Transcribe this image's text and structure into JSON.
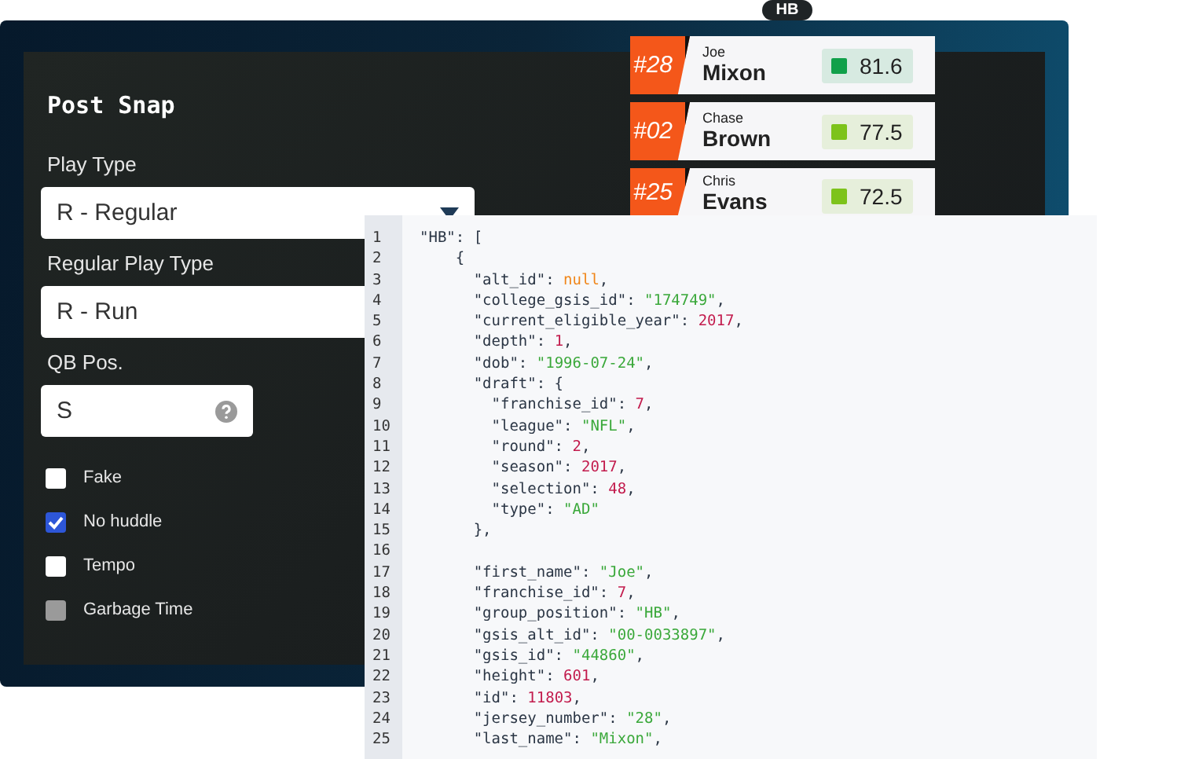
{
  "badge": "HB",
  "form": {
    "title": "Post Snap",
    "fields": [
      {
        "kind": "select",
        "label": "Play Type",
        "value": "R - Regular"
      },
      {
        "kind": "covered",
        "label": "Regular Play Type",
        "value": "R - Run"
      },
      {
        "kind": "input",
        "label": "QB Pos.",
        "value": "S"
      }
    ],
    "checkboxes": [
      {
        "label": "Fake",
        "checked": false,
        "disabled": false
      },
      {
        "label": "No huddle",
        "checked": true,
        "disabled": false
      },
      {
        "label": "Tempo",
        "checked": false,
        "disabled": false
      },
      {
        "label": "Garbage Time",
        "checked": false,
        "disabled": true
      }
    ]
  },
  "players": [
    {
      "number": "#28",
      "first_name": "Joe",
      "last_name": "Mixon",
      "rating": "81.6",
      "color": "#11a04a"
    },
    {
      "number": "#02",
      "first_name": "Chase",
      "last_name": "Brown",
      "rating": "77.5",
      "color": "#7dc31b"
    },
    {
      "number": "#25",
      "first_name": "Chris",
      "last_name": "Evans",
      "rating": "72.5",
      "color": "#7dc31b"
    }
  ],
  "code": [
    {
      "line": "1",
      "tokens": [
        {
          "kind": "key",
          "text": "\"HB\""
        },
        {
          "kind": "punct",
          "text": ": ["
        }
      ]
    },
    {
      "line": "2",
      "tokens": [
        {
          "kind": "punct",
          "text": "    {"
        }
      ]
    },
    {
      "line": "3",
      "tokens": [
        {
          "kind": "key",
          "text": "      \"alt_id\""
        },
        {
          "kind": "punct",
          "text": ": "
        },
        {
          "kind": "null",
          "text": "null"
        },
        {
          "kind": "punct",
          "text": ","
        }
      ]
    },
    {
      "line": "4",
      "tokens": [
        {
          "kind": "key",
          "text": "      \"college_gsis_id\""
        },
        {
          "kind": "punct",
          "text": ": "
        },
        {
          "kind": "string",
          "text": "\"174749\""
        },
        {
          "kind": "punct",
          "text": ","
        }
      ]
    },
    {
      "line": "5",
      "tokens": [
        {
          "kind": "key",
          "text": "      \"current_eligible_year\""
        },
        {
          "kind": "punct",
          "text": ": "
        },
        {
          "kind": "number",
          "text": "2017"
        },
        {
          "kind": "punct",
          "text": ","
        }
      ]
    },
    {
      "line": "6",
      "tokens": [
        {
          "kind": "key",
          "text": "      \"depth\""
        },
        {
          "kind": "punct",
          "text": ": "
        },
        {
          "kind": "number",
          "text": "1"
        },
        {
          "kind": "punct",
          "text": ","
        }
      ]
    },
    {
      "line": "7",
      "tokens": [
        {
          "kind": "key",
          "text": "      \"dob\""
        },
        {
          "kind": "punct",
          "text": ": "
        },
        {
          "kind": "string",
          "text": "\"1996-07-24\""
        },
        {
          "kind": "punct",
          "text": ","
        }
      ]
    },
    {
      "line": "8",
      "tokens": [
        {
          "kind": "key",
          "text": "      \"draft\""
        },
        {
          "kind": "punct",
          "text": ": {"
        }
      ]
    },
    {
      "line": "9",
      "tokens": [
        {
          "kind": "key",
          "text": "        \"franchise_id\""
        },
        {
          "kind": "punct",
          "text": ": "
        },
        {
          "kind": "number",
          "text": "7"
        },
        {
          "kind": "punct",
          "text": ","
        }
      ]
    },
    {
      "line": "10",
      "tokens": [
        {
          "kind": "key",
          "text": "        \"league\""
        },
        {
          "kind": "punct",
          "text": ": "
        },
        {
          "kind": "string",
          "text": "\"NFL\""
        },
        {
          "kind": "punct",
          "text": ","
        }
      ]
    },
    {
      "line": "11",
      "tokens": [
        {
          "kind": "key",
          "text": "        \"round\""
        },
        {
          "kind": "punct",
          "text": ": "
        },
        {
          "kind": "number",
          "text": "2"
        },
        {
          "kind": "punct",
          "text": ","
        }
      ]
    },
    {
      "line": "12",
      "tokens": [
        {
          "kind": "key",
          "text": "        \"season\""
        },
        {
          "kind": "punct",
          "text": ": "
        },
        {
          "kind": "number",
          "text": "2017"
        },
        {
          "kind": "punct",
          "text": ","
        }
      ]
    },
    {
      "line": "13",
      "tokens": [
        {
          "kind": "key",
          "text": "        \"selection\""
        },
        {
          "kind": "punct",
          "text": ": "
        },
        {
          "kind": "number",
          "text": "48"
        },
        {
          "kind": "punct",
          "text": ","
        }
      ]
    },
    {
      "line": "14",
      "tokens": [
        {
          "kind": "key",
          "text": "        \"type\""
        },
        {
          "kind": "punct",
          "text": ": "
        },
        {
          "kind": "string",
          "text": "\"AD\""
        }
      ]
    },
    {
      "line": "15",
      "tokens": [
        {
          "kind": "punct",
          "text": "      },"
        }
      ]
    },
    {
      "line": "16"
    },
    {
      "line": "17",
      "tokens": [
        {
          "kind": "key",
          "text": "      \"first_name\""
        },
        {
          "kind": "punct",
          "text": ": "
        },
        {
          "kind": "string",
          "text": "\"Joe\""
        },
        {
          "kind": "punct",
          "text": ","
        }
      ]
    },
    {
      "line": "18",
      "tokens": [
        {
          "kind": "key",
          "text": "      \"franchise_id\""
        },
        {
          "kind": "punct",
          "text": ": "
        },
        {
          "kind": "number",
          "text": "7"
        },
        {
          "kind": "punct",
          "text": ","
        }
      ]
    },
    {
      "line": "19",
      "tokens": [
        {
          "kind": "key",
          "text": "      \"group_position\""
        },
        {
          "kind": "punct",
          "text": ": "
        },
        {
          "kind": "string",
          "text": "\"HB\""
        },
        {
          "kind": "punct",
          "text": ","
        }
      ]
    },
    {
      "line": "20",
      "tokens": [
        {
          "kind": "key",
          "text": "      \"gsis_alt_id\""
        },
        {
          "kind": "punct",
          "text": ": "
        },
        {
          "kind": "string",
          "text": "\"00-0033897\""
        },
        {
          "kind": "punct",
          "text": ","
        }
      ]
    },
    {
      "line": "21",
      "tokens": [
        {
          "kind": "key",
          "text": "      \"gsis_id\""
        },
        {
          "kind": "punct",
          "text": ": "
        },
        {
          "kind": "string",
          "text": "\"44860\""
        },
        {
          "kind": "punct",
          "text": ","
        }
      ]
    },
    {
      "line": "22",
      "tokens": [
        {
          "kind": "key",
          "text": "      \"height\""
        },
        {
          "kind": "punct",
          "text": ": "
        },
        {
          "kind": "number",
          "text": "601"
        },
        {
          "kind": "punct",
          "text": ","
        }
      ]
    },
    {
      "line": "23",
      "tokens": [
        {
          "kind": "key",
          "text": "      \"id\""
        },
        {
          "kind": "punct",
          "text": ": "
        },
        {
          "kind": "number",
          "text": "11803"
        },
        {
          "kind": "punct",
          "text": ","
        }
      ]
    },
    {
      "line": "24",
      "tokens": [
        {
          "kind": "key",
          "text": "      \"jersey_number\""
        },
        {
          "kind": "punct",
          "text": ": "
        },
        {
          "kind": "string",
          "text": "\"28\""
        },
        {
          "kind": "punct",
          "text": ","
        }
      ]
    },
    {
      "line": "25",
      "tokens": [
        {
          "kind": "key",
          "text": "      \"last_name\""
        },
        {
          "kind": "punct",
          "text": ": "
        },
        {
          "kind": "string",
          "text": "\"Mixon\""
        },
        {
          "kind": "punct",
          "text": ","
        }
      ]
    }
  ]
}
